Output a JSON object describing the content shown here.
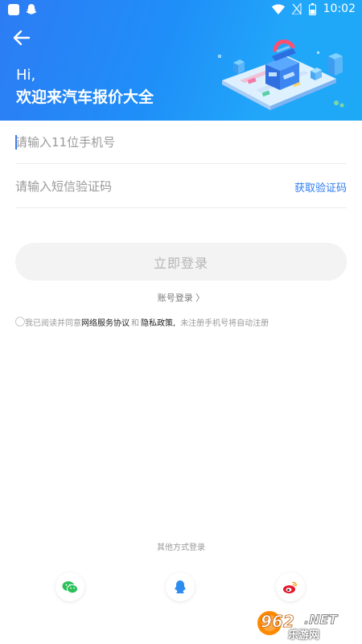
{
  "status_bar": {
    "time": "10:02"
  },
  "header": {
    "greeting_hi": "Hi,",
    "greeting_welcome": "欢迎来汽车报价大全"
  },
  "form": {
    "phone_placeholder": "请输入11位手机号",
    "phone_value": "",
    "code_placeholder": "请输入短信验证码",
    "code_value": "",
    "get_code_label": "获取验证码",
    "login_button_label": "立即登录",
    "account_login_label": "账号登录 〉"
  },
  "agreement": {
    "prefix": "我已阅读并同意",
    "service_link": "网络服务协议",
    "and": "和",
    "privacy_link": "隐私政策,",
    "suffix": "未注册手机号将自动注册"
  },
  "other_login": {
    "label": "其他方式登录",
    "icons": [
      "wechat-icon",
      "qq-icon",
      "weibo-icon"
    ]
  },
  "watermark": {
    "logo_text": "962.NET",
    "sub_text": "乐游网"
  },
  "colors": {
    "header_gradient_start": "#2d7cf4",
    "header_gradient_end": "#1ea9f6",
    "link": "#2d7cf4",
    "wechat": "#2bbf5a",
    "qq": "#2d8cf0",
    "weibo": "#e6162d"
  }
}
